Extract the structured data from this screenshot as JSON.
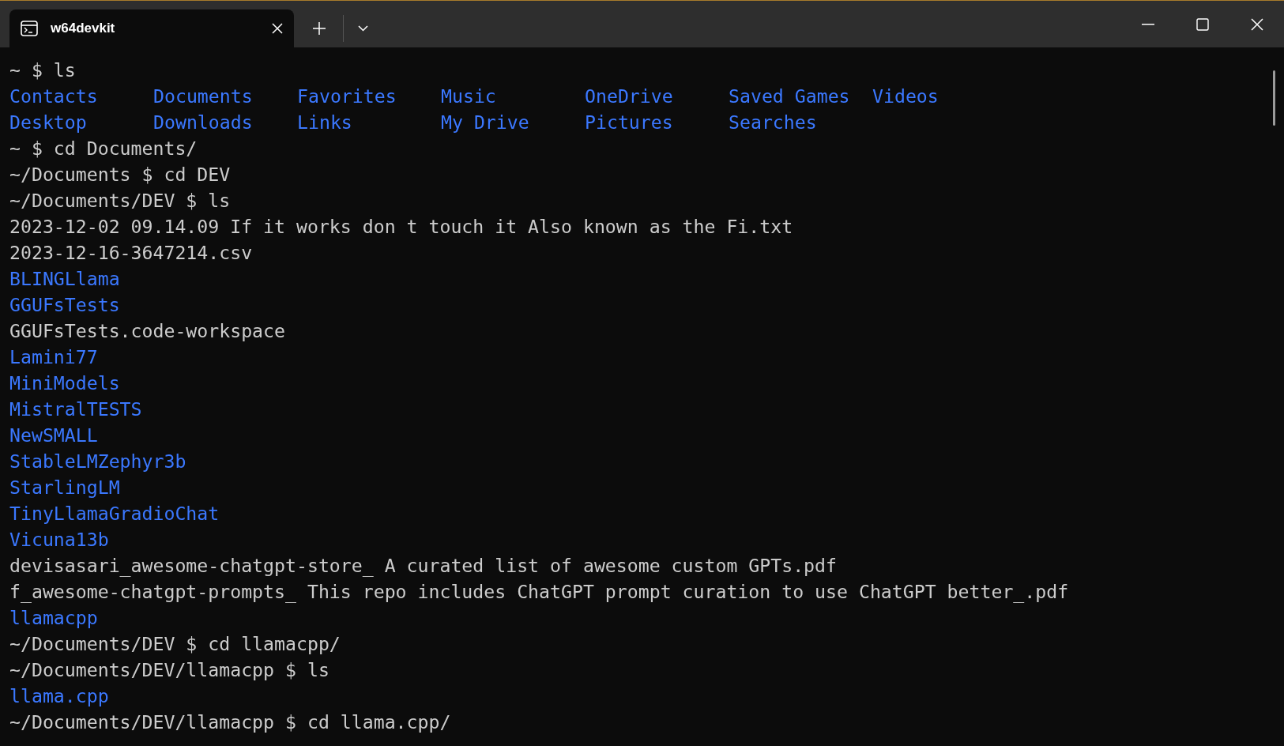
{
  "tab": {
    "title": "w64devkit",
    "selected": true
  },
  "terminal": {
    "lines": [
      {
        "kind": "prompt",
        "prompt": "~ $",
        "command": "ls"
      },
      {
        "kind": "grid",
        "entries": [
          {
            "name": "Contacts",
            "kind": "dir"
          },
          {
            "name": "Desktop",
            "kind": "dir"
          },
          {
            "name": "Documents",
            "kind": "dir"
          },
          {
            "name": "Downloads",
            "kind": "dir"
          },
          {
            "name": "Favorites",
            "kind": "dir"
          },
          {
            "name": "Links",
            "kind": "dir"
          },
          {
            "name": "Music",
            "kind": "dir"
          },
          {
            "name": "My Drive",
            "kind": "dir"
          },
          {
            "name": "OneDrive",
            "kind": "dir"
          },
          {
            "name": "Pictures",
            "kind": "dir"
          },
          {
            "name": "Saved Games",
            "kind": "dir"
          },
          {
            "name": "Searches",
            "kind": "dir"
          },
          {
            "name": "Videos",
            "kind": "dir"
          }
        ]
      },
      {
        "kind": "prompt",
        "prompt": "~ $",
        "command": "cd Documents/"
      },
      {
        "kind": "prompt",
        "prompt": "~/Documents $",
        "command": "cd DEV"
      },
      {
        "kind": "prompt",
        "prompt": "~/Documents/DEV $",
        "command": "ls"
      },
      {
        "kind": "file",
        "name": "2023-12-02 09.14.09 If it works don t touch it Also known as the Fi.txt"
      },
      {
        "kind": "file",
        "name": "2023-12-16-3647214.csv"
      },
      {
        "kind": "dir",
        "name": "BLINGLlama"
      },
      {
        "kind": "dir",
        "name": "GGUFsTests"
      },
      {
        "kind": "file",
        "name": "GGUFsTests.code-workspace"
      },
      {
        "kind": "dir",
        "name": "Lamini77"
      },
      {
        "kind": "dir",
        "name": "MiniModels"
      },
      {
        "kind": "dir",
        "name": "MistralTESTS"
      },
      {
        "kind": "dir",
        "name": "NewSMALL"
      },
      {
        "kind": "dir",
        "name": "StableLMZephyr3b"
      },
      {
        "kind": "dir",
        "name": "StarlingLM"
      },
      {
        "kind": "dir",
        "name": "TinyLlamaGradioChat"
      },
      {
        "kind": "dir",
        "name": "Vicuna13b"
      },
      {
        "kind": "file",
        "name": "devisasari_awesome-chatgpt-store_ A curated list of awesome custom GPTs.pdf"
      },
      {
        "kind": "file",
        "name": "f_awesome-chatgpt-prompts_ This repo includes ChatGPT prompt curation to use ChatGPT better_.pdf"
      },
      {
        "kind": "dir",
        "name": "llamacpp"
      },
      {
        "kind": "prompt",
        "prompt": "~/Documents/DEV $",
        "command": "cd llamacpp/"
      },
      {
        "kind": "prompt",
        "prompt": "~/Documents/DEV/llamacpp $",
        "command": "ls"
      },
      {
        "kind": "dir",
        "name": "llama.cpp"
      },
      {
        "kind": "prompt",
        "prompt": "~/Documents/DEV/llamacpp $",
        "command": "cd llama.cpp/"
      }
    ]
  }
}
